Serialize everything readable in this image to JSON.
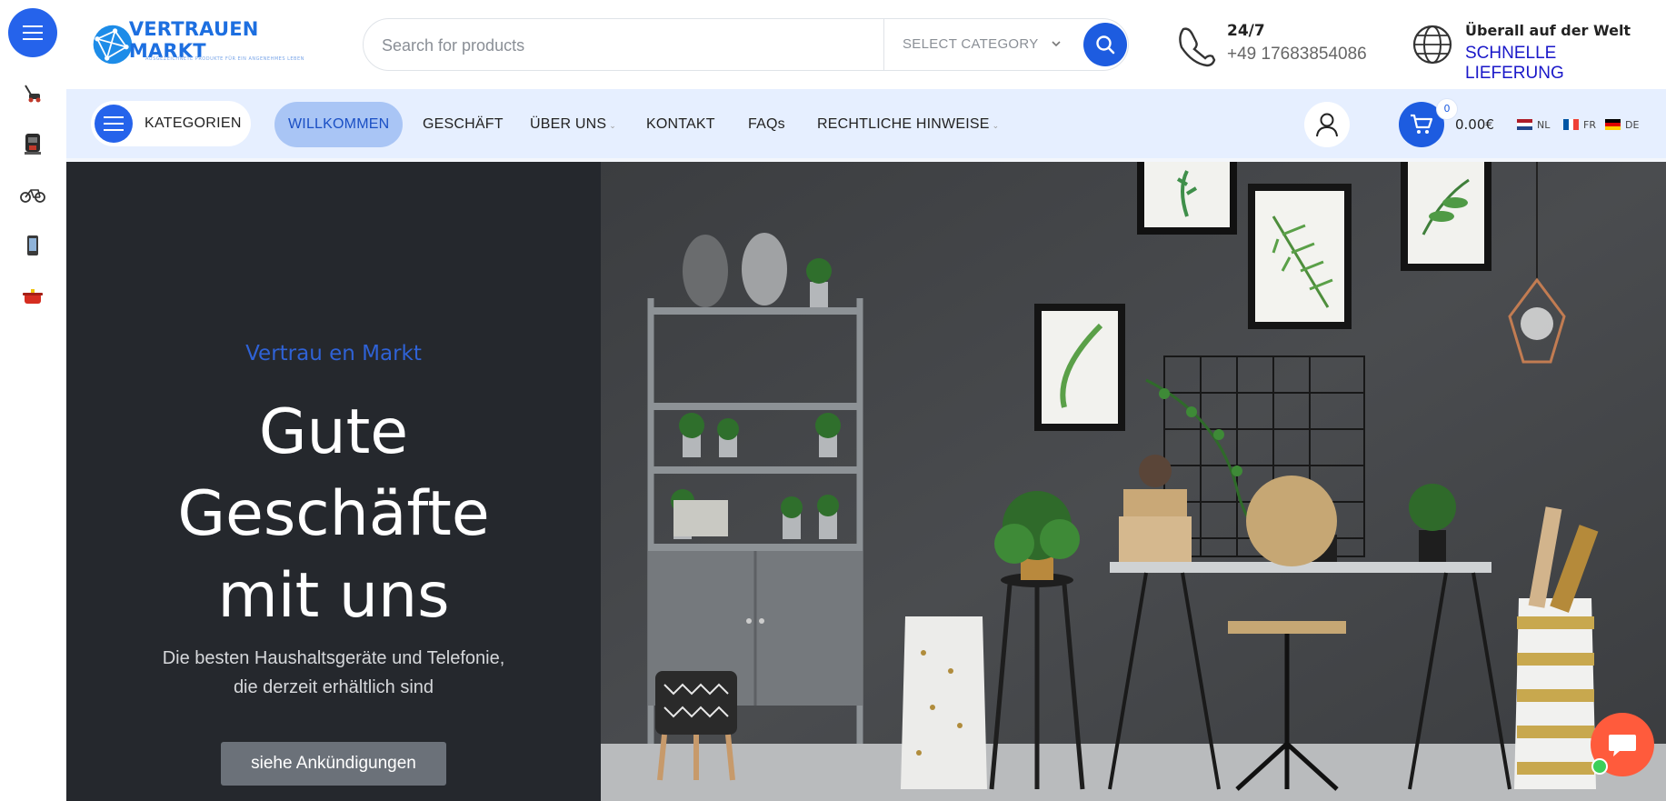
{
  "brand": {
    "name": "VERTRAUEN MARKT",
    "tagline": "AUSGEZEICHNETE PRODUKTE FÜR EIN ANGENEHMES LEBEN"
  },
  "search": {
    "placeholder": "Search for products",
    "category": "SELECT CATEGORY"
  },
  "contact": {
    "hours": "24/7",
    "phone": "+49 17683854086"
  },
  "shipping": {
    "headline": "Überall auf der Welt",
    "subline": "SCHNELLE LIEFERUNG"
  },
  "nav": {
    "categories_label": "KATEGORIEN",
    "items": [
      {
        "label": "WILLKOMMEN",
        "active": true
      },
      {
        "label": "GESCHÄFT"
      },
      {
        "label": "ÜBER UNS",
        "has_dropdown": true
      },
      {
        "label": "KONTAKT"
      },
      {
        "label": "FAQs"
      },
      {
        "label": "RECHTLICHE HINWEISE",
        "has_dropdown": true
      }
    ],
    "dropdown_caret": "⌄"
  },
  "cart": {
    "count": "0",
    "total": "0.00€"
  },
  "languages": [
    {
      "code": "NL"
    },
    {
      "code": "FR"
    },
    {
      "code": "DE"
    }
  ],
  "rail": {
    "items": [
      "lawn-mower-icon",
      "espresso-machine-icon",
      "bicycle-icon",
      "smartphone-icon",
      "cookware-icon"
    ]
  },
  "hero": {
    "eyebrow": "Vertrau en Markt",
    "title_line1": "Gute",
    "title_line2": "Geschäfte",
    "title_line3": "mit uns",
    "desc_line1": "Die besten Haushaltsgeräte und Telefonie,",
    "desc_line2": "die derzeit erhältlich sind",
    "button": "siehe Ankündigungen"
  },
  "colors": {
    "primary": "#1d5ce0",
    "nav_bg": "#e6efff",
    "hero_panel": "#25282d",
    "accent_text": "#2f62d6",
    "chat": "#ff5b3c"
  }
}
